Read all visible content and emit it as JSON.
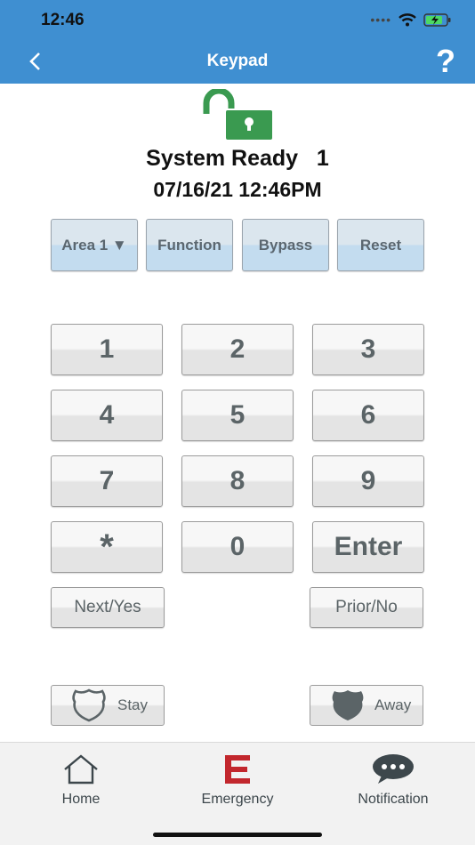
{
  "status_bar": {
    "time": "12:46"
  },
  "nav": {
    "title": "Keypad",
    "help": "?"
  },
  "panel": {
    "status": "System Ready   1",
    "datetime": "07/16/21 12:46PM"
  },
  "function_buttons": {
    "area": "Area 1 ▼",
    "function": "Function",
    "bypass": "Bypass",
    "reset": "Reset"
  },
  "keys": {
    "k1": "1",
    "k2": "2",
    "k3": "3",
    "k4": "4",
    "k5": "5",
    "k6": "6",
    "k7": "7",
    "k8": "8",
    "k9": "9",
    "star": "*",
    "k0": "0",
    "enter": "Enter"
  },
  "nav_keys": {
    "next": "Next/Yes",
    "prior": "Prior/No"
  },
  "arm": {
    "stay": "Stay",
    "away": "Away"
  },
  "tabs": {
    "home": "Home",
    "emergency": "Emergency",
    "notification": "Notification"
  },
  "colors": {
    "header": "#3f8fd1",
    "lock": "#3a9a50",
    "emergency": "#c2272d"
  }
}
